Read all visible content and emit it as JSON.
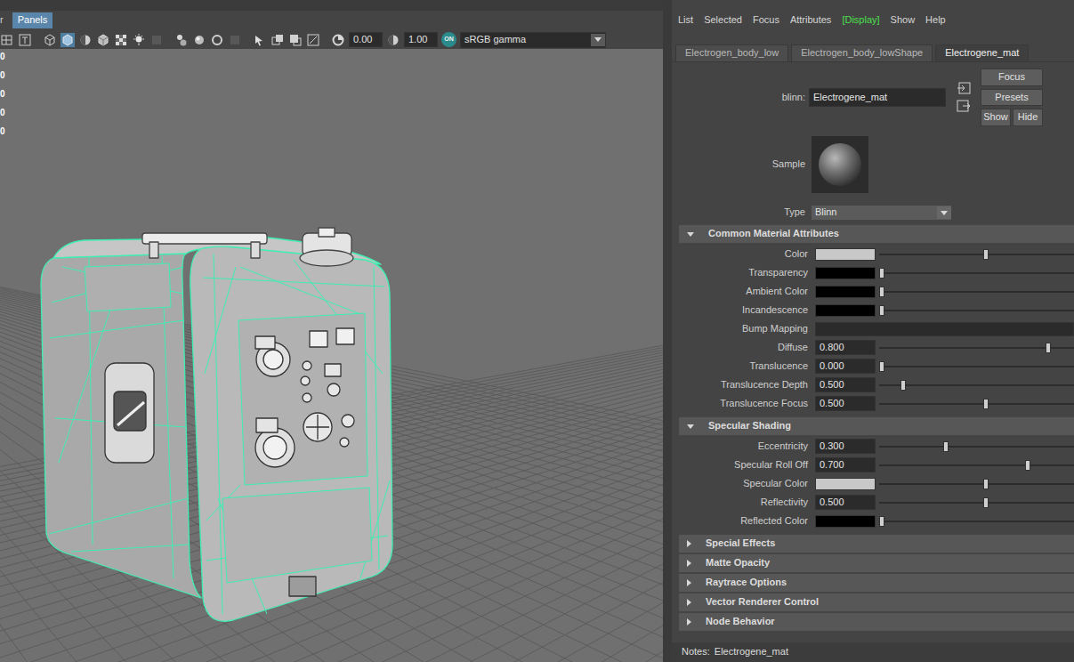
{
  "viewport": {
    "menu": [
      {
        "label": "r",
        "selected": false
      },
      {
        "label": "Panels",
        "selected": true
      }
    ],
    "toolbar": [
      {
        "kind": "icon",
        "selected": false,
        "disabled": false
      },
      {
        "kind": "icon",
        "selected": false,
        "disabled": false
      },
      {
        "kind": "icon",
        "selected": false,
        "disabled": false
      },
      {
        "kind": "icon",
        "selected": true,
        "disabled": false
      },
      {
        "kind": "icon",
        "selected": false,
        "disabled": false
      },
      {
        "kind": "icon",
        "selected": false,
        "disabled": false
      },
      {
        "kind": "icon",
        "selected": false,
        "disabled": false
      },
      {
        "kind": "icon",
        "selected": false,
        "disabled": false
      },
      {
        "kind": "icon",
        "selected": false,
        "disabled": true
      },
      {
        "kind": "icon",
        "selected": false,
        "disabled": false
      },
      {
        "kind": "icon",
        "selected": false,
        "disabled": false
      },
      {
        "kind": "icon",
        "selected": false,
        "disabled": false
      },
      {
        "kind": "icon",
        "selected": false,
        "disabled": true
      },
      {
        "kind": "icon",
        "selected": false,
        "disabled": false
      },
      {
        "kind": "icon",
        "selected": false,
        "disabled": false
      },
      {
        "kind": "icon",
        "selected": false,
        "disabled": false
      },
      {
        "kind": "icon",
        "selected": false,
        "disabled": false
      },
      {
        "kind": "icon",
        "selected": false,
        "disabled": false
      },
      {
        "kind": "field",
        "value": "0.00"
      },
      {
        "kind": "icon",
        "selected": false,
        "disabled": false
      },
      {
        "kind": "field",
        "value": "1.00"
      },
      {
        "kind": "toggle",
        "label": "ON",
        "on": true
      },
      {
        "kind": "dropdown",
        "value": "sRGB gamma"
      }
    ],
    "hud": [
      "0",
      "0",
      "0",
      "0",
      "0"
    ]
  },
  "attribute_editor": {
    "menu": [
      {
        "label": "List",
        "highlighted": false
      },
      {
        "label": "Selected",
        "highlighted": false
      },
      {
        "label": "Focus",
        "highlighted": false
      },
      {
        "label": "Attributes",
        "highlighted": false
      },
      {
        "label": "[Display]",
        "highlighted": true
      },
      {
        "label": "Show",
        "highlighted": false
      },
      {
        "label": "Help",
        "highlighted": false
      }
    ],
    "tabs": [
      {
        "label": "Electrogen_body_low",
        "selected": false
      },
      {
        "label": "Electrogen_body_lowShape",
        "selected": false
      },
      {
        "label": "Electrogene_mat",
        "selected": true
      }
    ],
    "node": {
      "type_label": "blinn:",
      "name": "Electrogene_mat"
    },
    "buttons": [
      "Focus",
      "Presets",
      "Show",
      "Hide"
    ],
    "sample_label": "Sample",
    "type": {
      "label": "Type",
      "value": "Blinn"
    },
    "sections": [
      {
        "title": "Common Material Attributes",
        "expanded": true,
        "rows": [
          {
            "label": "Color",
            "kind": "color",
            "color": "#c8c8c8",
            "level": 0.55
          },
          {
            "label": "Transparency",
            "kind": "color",
            "color": "#000000",
            "level": 0
          },
          {
            "label": "Ambient Color",
            "kind": "color",
            "color": "#000000",
            "level": 0
          },
          {
            "label": "Incandescence",
            "kind": "color",
            "color": "#000000",
            "level": 0
          },
          {
            "label": "Bump Mapping",
            "kind": "map"
          },
          {
            "label": "Diffuse",
            "kind": "number",
            "value": "0.800",
            "level": 0.88
          },
          {
            "label": "Translucence",
            "kind": "number",
            "value": "0.000",
            "level": 0
          },
          {
            "label": "Translucence Depth",
            "kind": "number",
            "value": "0.500",
            "level": 0.115
          },
          {
            "label": "Translucence Focus",
            "kind": "number",
            "value": "0.500",
            "level": 0.55
          }
        ]
      },
      {
        "title": "Specular Shading",
        "expanded": true,
        "rows": [
          {
            "label": "Eccentricity",
            "kind": "number",
            "value": "0.300",
            "level": 0.34
          },
          {
            "label": "Specular Roll Off",
            "kind": "number",
            "value": "0.700",
            "level": 0.77
          },
          {
            "label": "Specular Color",
            "kind": "color",
            "color": "#c8c8c8",
            "level": 0.55
          },
          {
            "label": "Reflectivity",
            "kind": "number",
            "value": "0.500",
            "level": 0.55
          },
          {
            "label": "Reflected Color",
            "kind": "color",
            "color": "#000000",
            "level": 0
          }
        ]
      },
      {
        "title": "Special Effects",
        "expanded": false,
        "rows": []
      },
      {
        "title": "Matte Opacity",
        "expanded": false,
        "rows": []
      },
      {
        "title": "Raytrace Options",
        "expanded": false,
        "rows": []
      },
      {
        "title": "Vector Renderer Control",
        "expanded": false,
        "rows": []
      },
      {
        "title": "Node Behavior",
        "expanded": false,
        "rows": []
      }
    ],
    "notes": {
      "label": "Notes:",
      "value": "Electrogene_mat"
    }
  }
}
